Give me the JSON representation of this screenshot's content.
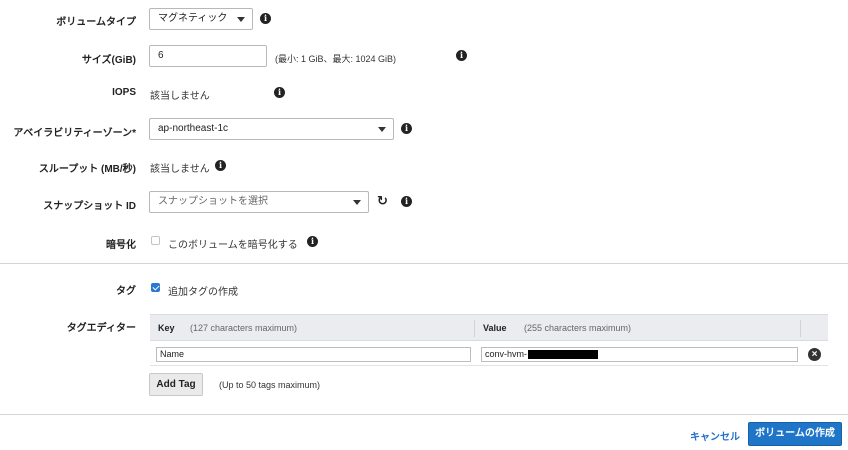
{
  "volume_type": {
    "label": "ボリュームタイプ",
    "value": "マグネティック"
  },
  "size": {
    "label": "サイズ(GiB)",
    "value": "6",
    "hint": "(最小: 1 GiB、最大: 1024 GiB)"
  },
  "iops": {
    "label": "IOPS",
    "value": "該当しません"
  },
  "availability_zone": {
    "label": "アベイラビリティーゾーン*",
    "value": "ap-northeast-1c"
  },
  "throughput": {
    "label": "スループット (MB/秒)",
    "value": "該当しません"
  },
  "snapshot": {
    "label": "スナップショット ID",
    "placeholder": "スナップショットを選択"
  },
  "encryption": {
    "label": "暗号化",
    "checkbox_label": "このボリュームを暗号化する",
    "checked": false
  },
  "tags": {
    "label": "タグ",
    "checkbox_label": "追加タグの作成",
    "checked": true
  },
  "tag_editor": {
    "label": "タグエディター",
    "key_header": "Key",
    "key_note": "(127 characters maximum)",
    "value_header": "Value",
    "value_note": "(255 characters maximum)",
    "rows": [
      {
        "key": "Name",
        "value": "conv-hvm-"
      }
    ],
    "add_button": "Add Tag",
    "add_hint": "(Up to 50 tags maximum)"
  },
  "footer": {
    "cancel": "キャンセル",
    "create": "ボリュームの作成"
  },
  "colors": {
    "primary": "#1f76c8",
    "link": "#1f6fc5",
    "table_header": "#eaecef"
  },
  "icons": {
    "info": "info-icon",
    "refresh": "refresh-icon",
    "remove": "remove-icon",
    "caret": "chevron-down-icon"
  }
}
